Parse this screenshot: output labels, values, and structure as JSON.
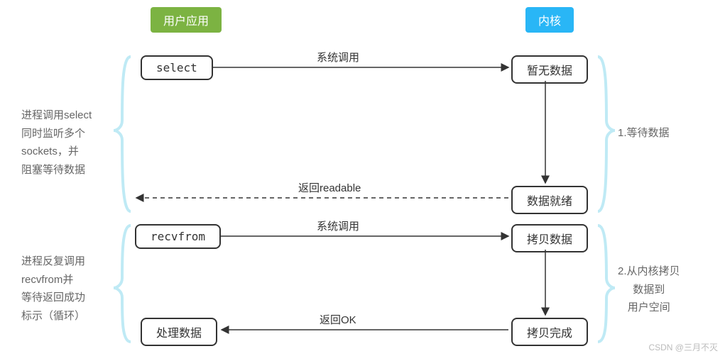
{
  "headers": {
    "user_app": "用户应用",
    "kernel": "内核"
  },
  "boxes": {
    "select": "select",
    "no_data": "暂无数据",
    "data_ready": "数据就绪",
    "recvfrom": "recvfrom",
    "copy_data": "拷贝数据",
    "copy_done": "拷贝完成",
    "process_data": "处理数据"
  },
  "arrows": {
    "syscall1": "系统调用",
    "return_readable": "返回readable",
    "syscall2": "系统调用",
    "return_ok": "返回OK"
  },
  "notes": {
    "left_top_l1": "进程调用select",
    "left_top_l2": "同时监听多个",
    "left_top_l3": "sockets，并",
    "left_top_l4": "阻塞等待数据",
    "left_bottom_l1": "进程反复调用",
    "left_bottom_l2": "recvfrom并",
    "left_bottom_l3": "等待返回成功",
    "left_bottom_l4": "标示（循环）",
    "right_top": "1.等待数据",
    "right_bottom_l1": "2.从内核拷贝",
    "right_bottom_l2": "数据到",
    "right_bottom_l3": "用户空间"
  },
  "watermark": "CSDN @三月不灭"
}
